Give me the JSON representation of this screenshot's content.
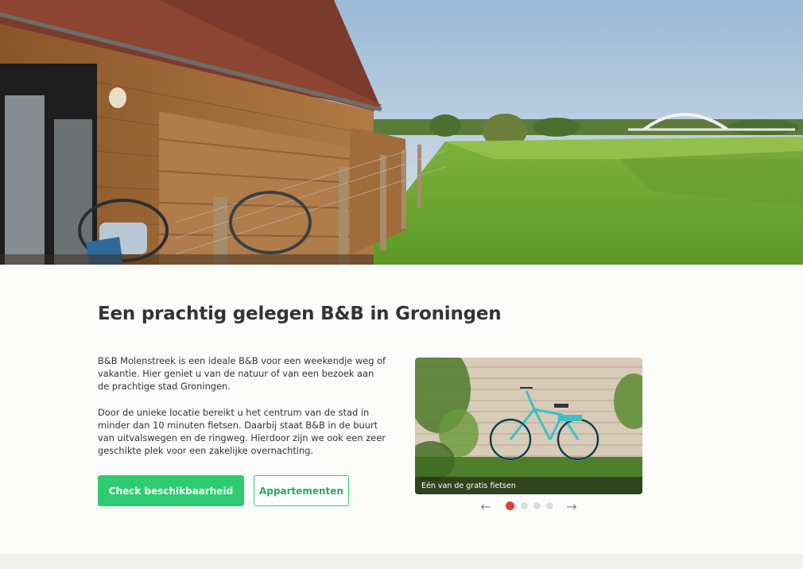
{
  "hero": {
    "image": "bnb-terrace-countryside-photo"
  },
  "main": {
    "title": "Een prachtig gelegen B&B in Groningen",
    "paragraph1": "B&B Molenstreek is een ideale B&B voor een weekendje weg of vakantie. Hier geniet u van de natuur of van een bezoek aan de prachtige stad Groningen.",
    "paragraph2": "Door de unieke locatie bereikt u het centrum van de stad in minder dan 10 minuten fietsen. Daarbij staat B&B in de buurt van uitvalswegen en de ringweg. Hierdoor zijn we ook een zeer geschikte plek voor een zakelijke overnachting.",
    "primary_button": "Check beschikbaarheid",
    "secondary_button": "Appartementen"
  },
  "slider": {
    "caption": "Eén van de gratis fietsen",
    "prev_icon": "←",
    "next_icon": "→",
    "slide_count": 4,
    "active_slide": 1
  },
  "colors": {
    "accent": "#2ecc71",
    "active_dot": "#e53a2f",
    "inactive_dot": "#d9dedd"
  }
}
